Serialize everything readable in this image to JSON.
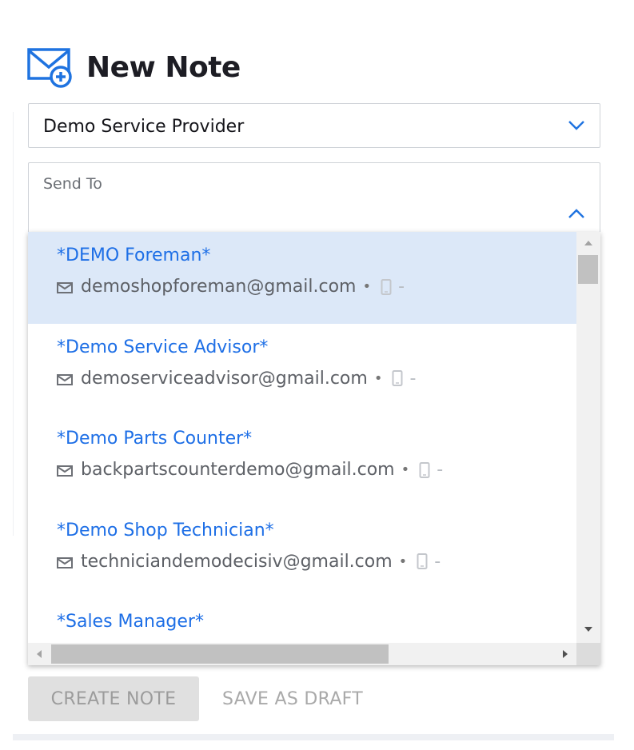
{
  "header": {
    "title": "New Note",
    "icon": "mail-add-icon"
  },
  "provider_select": {
    "value": "Demo Service Provider"
  },
  "send_to": {
    "label": "Send To"
  },
  "recipients": [
    {
      "name": "*DEMO Foreman*",
      "email": "demoshopforeman@gmail.com",
      "separator": "•",
      "phone": "-",
      "selected": true
    },
    {
      "name": "*Demo Service Advisor*",
      "email": "demoserviceadvisor@gmail.com",
      "separator": "•",
      "phone": "-",
      "selected": false
    },
    {
      "name": "*Demo Parts Counter*",
      "email": "backpartscounterdemo@gmail.com",
      "separator": "•",
      "phone": "-",
      "selected": false
    },
    {
      "name": "*Demo Shop Technician*",
      "email": "techniciandemodecisiv@gmail.com",
      "separator": "•",
      "phone": "-",
      "selected": false
    },
    {
      "name": "*Sales Manager*",
      "email": "",
      "separator": "",
      "phone": "",
      "selected": false
    }
  ],
  "actions": {
    "create_label": "CREATE NOTE",
    "draft_label": "SAVE AS DRAFT"
  },
  "colors": {
    "accent": "#1e6fe6",
    "selected_row": "#dce8f8",
    "icon_blue": "#1f73e0"
  }
}
